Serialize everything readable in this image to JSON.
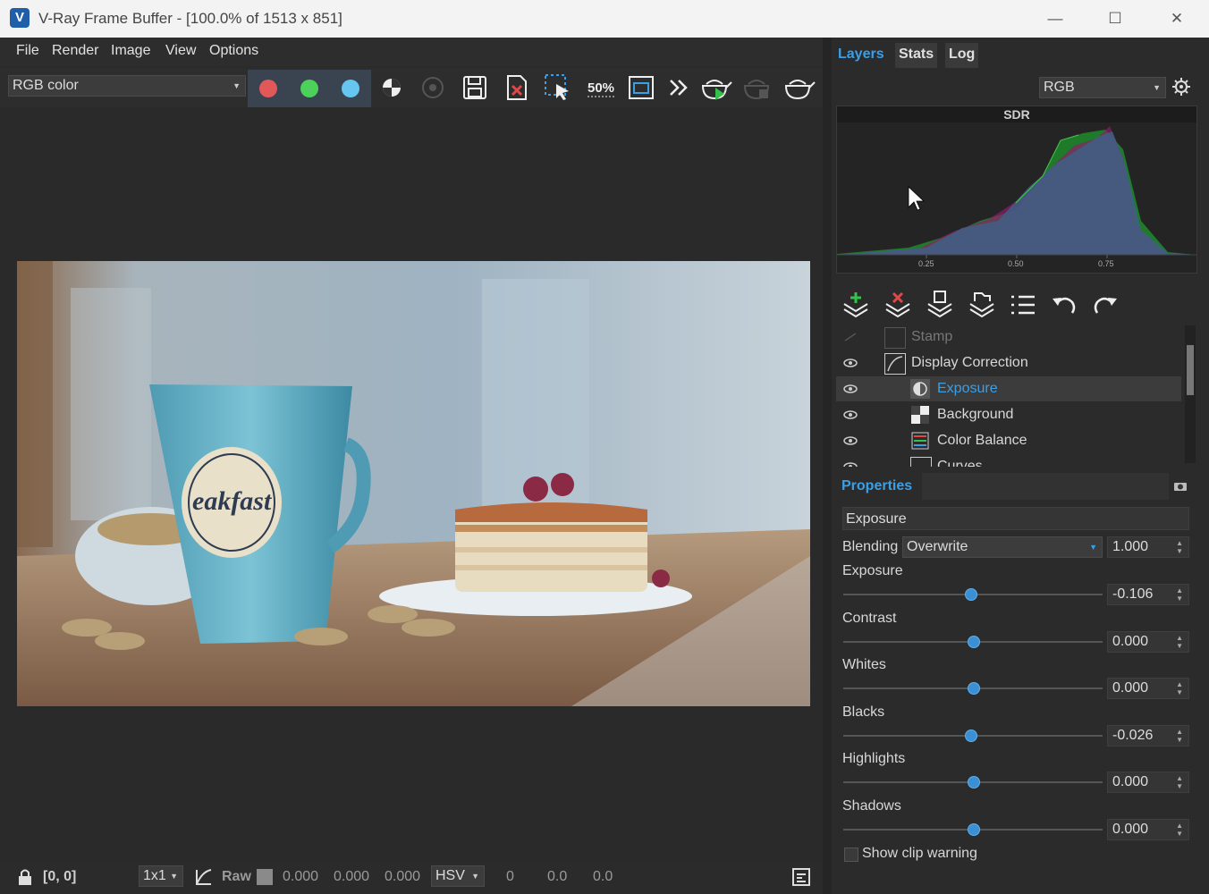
{
  "window": {
    "title": "V-Ray Frame Buffer - [100.0% of 1513 x 851]",
    "controls": [
      "—",
      "☐",
      "✕"
    ]
  },
  "menu": [
    "File",
    "Render",
    "Image",
    "View",
    "Options"
  ],
  "toolbar": {
    "channel_select": "RGB color",
    "channel_colors": [
      "#e0585a",
      "#4cd25a",
      "#66c6f0"
    ],
    "tools": [
      "contrast-icon",
      "track-mouse-icon",
      "save-icon",
      "clear-image-icon",
      "region-render-icon",
      "zoom-50-icon",
      "fit-window-icon",
      "more-icon",
      "render-interactive-icon",
      "stop-render-icon",
      "render-icon"
    ],
    "zoom_label": "50%"
  },
  "statusbar": {
    "coords": "[0, 0]",
    "sampling": "1x1",
    "raw_label": "Raw",
    "raw_values": [
      "0.000",
      "0.000",
      "0.000"
    ],
    "color_mode": "HSV",
    "hsv_values": [
      "0",
      "0.0",
      "0.0"
    ]
  },
  "right_panel": {
    "tabs": [
      "Layers",
      "Stats",
      "Log"
    ],
    "active_tab": "Layers",
    "display_select": "RGB",
    "histogram": {
      "header": "SDR",
      "ticks": [
        "0.25",
        "0.50",
        "0.75"
      ]
    },
    "layer_tools": [
      "add-layer-icon",
      "delete-layer-icon",
      "save-layers-icon",
      "load-layers-icon",
      "layer-list-icon",
      "undo-icon",
      "redo-icon"
    ],
    "layers": [
      {
        "name": "Stamp",
        "visible": false,
        "indent": 1,
        "icon": "stamp-icon",
        "disabled": true
      },
      {
        "name": "Display Correction",
        "visible": true,
        "indent": 1,
        "icon": "curve-icon"
      },
      {
        "name": "Exposure",
        "visible": true,
        "indent": 2,
        "icon": "exposure-icon",
        "selected": true
      },
      {
        "name": "Background",
        "visible": true,
        "indent": 2,
        "icon": "background-icon"
      },
      {
        "name": "Color Balance",
        "visible": true,
        "indent": 2,
        "icon": "color-balance-icon"
      },
      {
        "name": "Curves",
        "visible": true,
        "indent": 2,
        "icon": "curves-icon"
      }
    ]
  },
  "properties": {
    "header": "Properties",
    "layer_name": "Exposure",
    "blending_label": "Blending",
    "blending_mode": "Overwrite",
    "blending_amount": "1.000",
    "sliders": [
      {
        "label": "Exposure",
        "value": "-0.106",
        "level": 0.49
      },
      {
        "label": "Contrast",
        "value": "0.000",
        "level": 0.5
      },
      {
        "label": "Whites",
        "value": "0.000",
        "level": 0.5
      },
      {
        "label": "Blacks",
        "value": "-0.026",
        "level": 0.49
      },
      {
        "label": "Highlights",
        "value": "0.000",
        "level": 0.5
      },
      {
        "label": "Shadows",
        "value": "0.000",
        "level": 0.5
      }
    ],
    "clip_warning_label": "Show clip warning"
  },
  "colors": {
    "accent_blue": "#3b9fe6",
    "panel_bg": "#2b2b2b",
    "selected_row": "#3c3c3c"
  }
}
